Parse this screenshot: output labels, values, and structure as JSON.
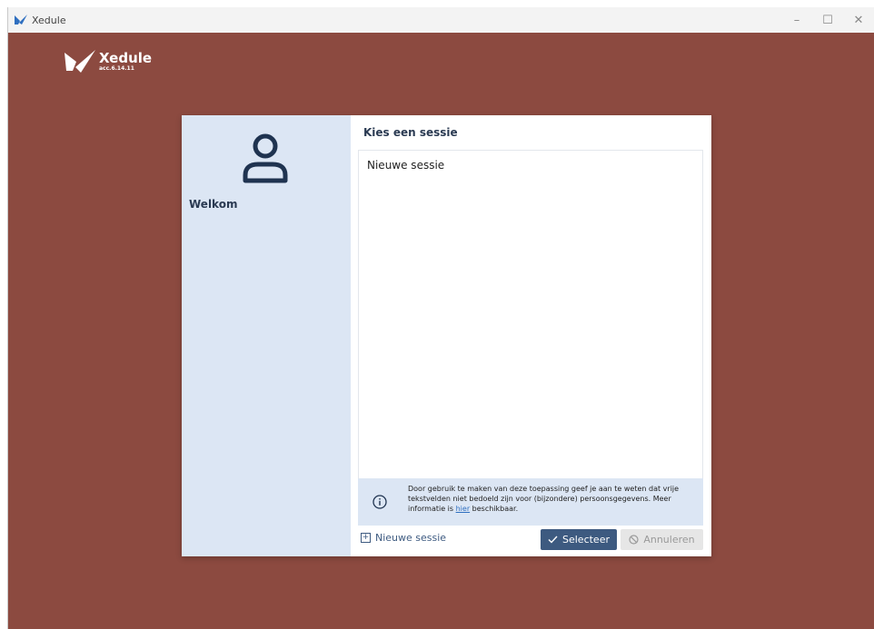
{
  "window": {
    "title": "Xedule",
    "controls": {
      "minimize": "–",
      "maximize": "☐",
      "close": "✕"
    }
  },
  "brand": {
    "name": "Xedule",
    "version": "acc.6.14.11"
  },
  "left_panel": {
    "welcome": "Welkom"
  },
  "right_panel": {
    "title": "Kies een sessie",
    "sessions": [
      {
        "label": "Nieuwe sessie"
      }
    ]
  },
  "info": {
    "text_before": "Door gebruik te maken van deze toepassing geef je aan te weten dat vrije tekstvelden niet bedoeld zijn voor (bijzondere) persoonsgegevens. Meer informatie is ",
    "link": "hier",
    "text_after": " beschikbaar."
  },
  "footer": {
    "new_session": "Nieuwe sessie",
    "select": "Selecteer",
    "cancel": "Annuleren"
  },
  "colors": {
    "background": "#8c4a40",
    "panel": "#dce6f4",
    "primary": "#3d5a80"
  }
}
